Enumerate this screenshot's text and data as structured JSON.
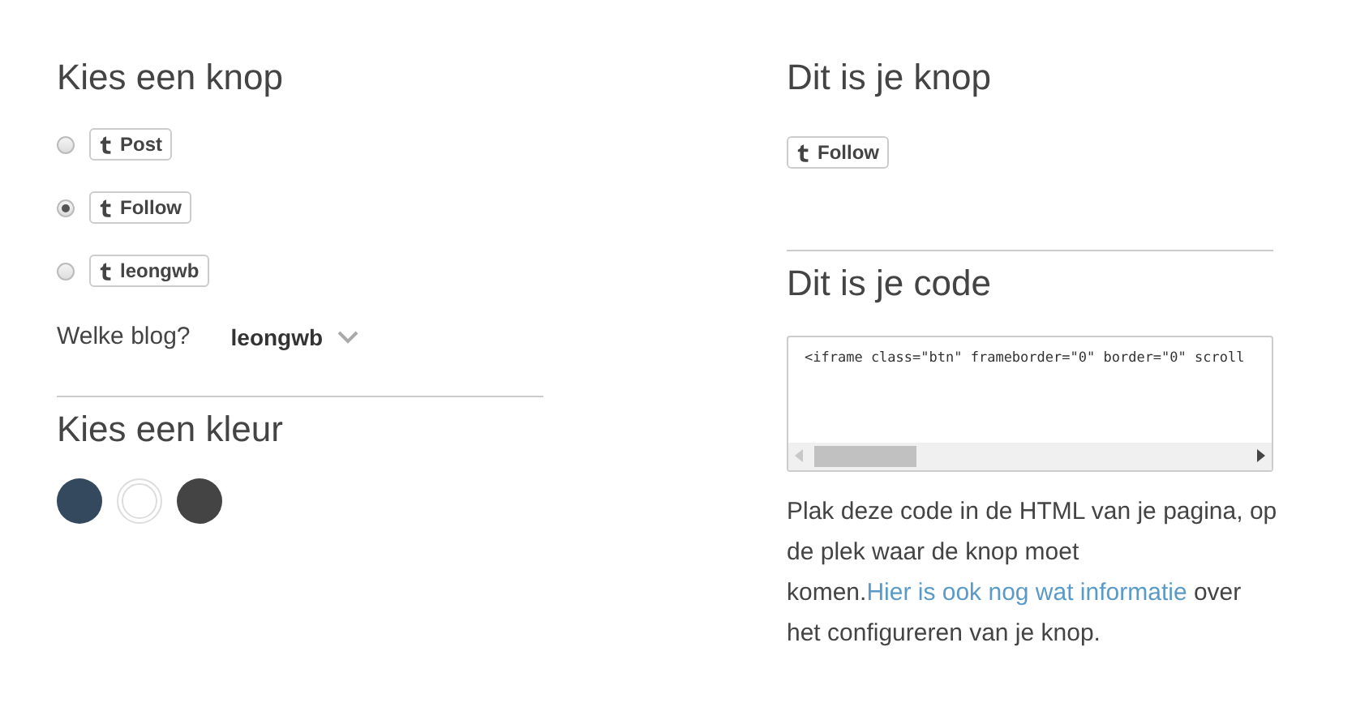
{
  "left": {
    "heading": "Kies een knop",
    "options": [
      {
        "label": "Post",
        "selected": false
      },
      {
        "label": "Follow",
        "selected": true
      },
      {
        "label": "leongwb",
        "selected": false
      }
    ],
    "blog": {
      "label": "Welke blog?",
      "value": "leongwb"
    },
    "color_heading": "Kies een kleur",
    "colors": [
      {
        "color": "#34495e"
      },
      {
        "color": "#ffffff"
      },
      {
        "color": "#444444"
      }
    ]
  },
  "right": {
    "heading": "Dit is je knop",
    "preview_button": "Follow",
    "code_heading": "Dit is je code",
    "code": "<iframe class=\"btn\" frameborder=\"0\" border=\"0\" scroll",
    "text_before": "Plak deze code in de HTML van je pagina, op de plek waar de knop moet komen.",
    "link": "Hier is ook nog wat informatie",
    "text_after": " over het configureren van je knop."
  }
}
